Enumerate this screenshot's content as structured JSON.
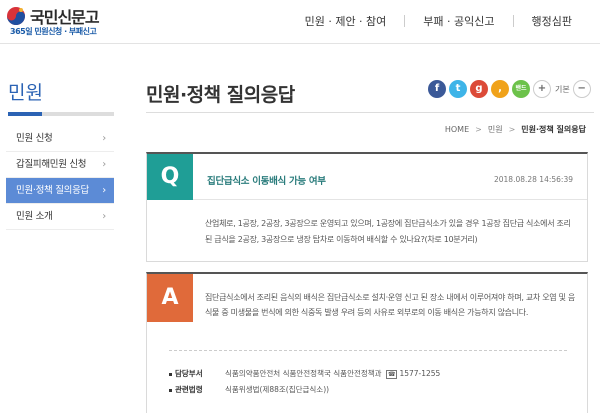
{
  "header": {
    "logo_title": "국민신문고",
    "logo_sub": "365일 민원신청 · 부패신고",
    "nav": [
      "민원 · 제안 · 참여",
      "부패 · 공익신고",
      "행정심판"
    ]
  },
  "sidebar": {
    "title": "민원",
    "items": [
      {
        "label": "민원 신청",
        "active": false
      },
      {
        "label": "갑질피해민원 신청",
        "active": false
      },
      {
        "label": "민원·정책 질의응답",
        "active": true
      },
      {
        "label": "민원 소개",
        "active": false
      }
    ]
  },
  "page": {
    "title": "민원·정책 질의응답"
  },
  "share": {
    "icons": [
      "facebook-icon",
      "twitter-icon",
      "google-plus-icon",
      "kakao-story-icon",
      "band-icon"
    ],
    "band_label": "밴드",
    "font_size_label": "기본"
  },
  "breadcrumb": [
    "HOME",
    "민원",
    "민원·정책 질의응답"
  ],
  "question": {
    "badge": "Q",
    "title": "집단급식소 이동배식 가능 여부",
    "date": "2018.08.28  14:56:39",
    "body": "산업체로, 1공장, 2공장, 3공장으로 운영되고 있으며, 1공장에 집단급식소가 있을 경우 1공장 집단급 식소에서 조리된 급식을 2공장, 3공장으로 냉장 탑차로 이동하여 배식할 수 있나요?(차로 10분거리)"
  },
  "answer": {
    "badge": "A",
    "body": "집단급식소에서 조리된 음식의 배식은 집단급식소로 설치·운영 신고 된 장소 내에서 이루어져야 하며, 교차 오염 및 음식물 중 미생물을 번식에 의한 식중독 발생 우려 등의 사유로 외부로의 이동 배식은 가능하지 않습니다.",
    "dept_label": "담당부서",
    "dept_value": "식품의약품안전처 식품안전정책국 식품안전정책과",
    "phone_icon_label": "☎",
    "phone": "1577-1255",
    "law_label": "관련법령",
    "law_value": "식품위생법(제88조(집단급식소))"
  },
  "colors": {
    "primary_blue": "#2b63b4",
    "active_menu": "#5c8bd6",
    "q_teal": "#1f9e96",
    "a_orange": "#e06a3a"
  }
}
